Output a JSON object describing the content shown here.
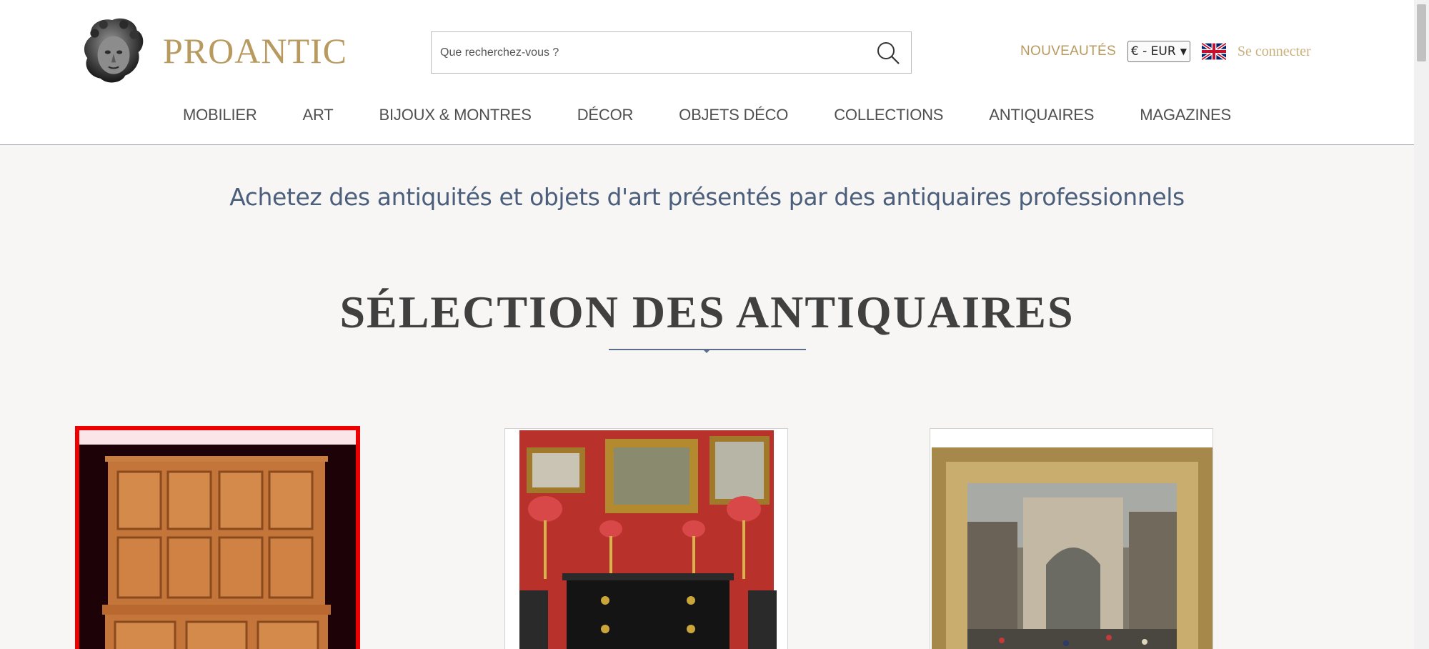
{
  "header": {
    "logo_text": "PROANTIC",
    "search": {
      "placeholder": "Que recherchez-vous ?",
      "value": ""
    },
    "new_label": "NOUVEAUTÉS",
    "currency": "€ - EUR",
    "login_label": "Se connecter"
  },
  "nav": {
    "items": [
      {
        "label": "MOBILIER"
      },
      {
        "label": "ART"
      },
      {
        "label": "BIJOUX & MONTRES"
      },
      {
        "label": "DÉCOR"
      },
      {
        "label": "OBJETS DÉCO"
      },
      {
        "label": "COLLECTIONS"
      },
      {
        "label": "ANTIQUAIRES"
      },
      {
        "label": "MAGAZINES"
      }
    ]
  },
  "main": {
    "tagline": "Achetez des antiquités et objets d'art présentés par des antiquaires professionnels",
    "section_title": "SÉLECTION DES ANTIQUAIRES",
    "cards": [
      {
        "subject": "pine-cupboard"
      },
      {
        "subject": "red-salon-with-paintings-and-commode"
      },
      {
        "subject": "framed-painting-porte-saint-denis"
      }
    ]
  },
  "colors": {
    "brand_gold": "#b89a5e",
    "tagline_blue": "#4b5f7c",
    "selection_red": "#ee0000"
  },
  "icons": [
    "logo-head-icon",
    "search-icon",
    "uk-flag-icon",
    "chevron-down-icon",
    "diamond-divider-icon"
  ]
}
